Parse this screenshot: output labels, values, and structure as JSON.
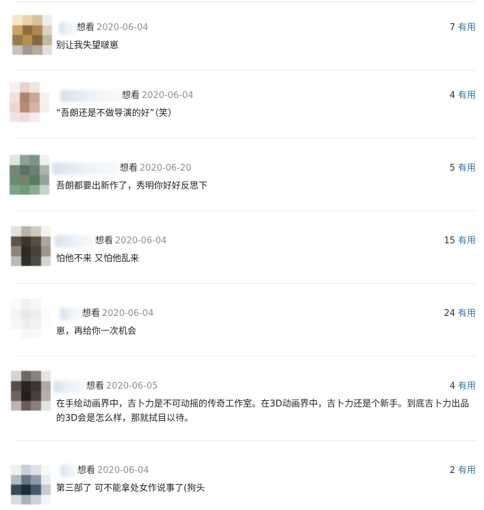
{
  "comments": [
    {
      "status": "想看",
      "date": "2020-06-04",
      "votes": "7",
      "useful": "有用",
      "content": "别让我失望啵崽"
    },
    {
      "status": "想看",
      "date": "2020-06-04",
      "votes": "4",
      "useful": "有用",
      "content": "“吾朗还是不做导演的好”（笑）"
    },
    {
      "status": "想看",
      "date": "2020-06-20",
      "votes": "5",
      "useful": "有用",
      "content": "吾朗都要出新作了，秀明你好好反思下"
    },
    {
      "status": "想看",
      "date": "2020-06-04",
      "votes": "15",
      "useful": "有用",
      "content": "怕他不来 又怕他乱来"
    },
    {
      "status": "想看",
      "date": "2020-06-04",
      "votes": "24",
      "useful": "有用",
      "content": "崽，再给你一次机会"
    },
    {
      "status": "想看",
      "date": "2020-06-05",
      "votes": "4",
      "useful": "有用",
      "content": "在手绘动画界中，吉卜力是不可动摇的传奇工作室。在3D动画界中，吉卜力还是个新手。到底吉卜力出品的3D会是怎么样，那就拭目以待。"
    },
    {
      "status": "想看",
      "date": "2020-06-04",
      "votes": "2",
      "useful": "有用",
      "content": "第三部了 可不能拿处女作说事了(狗头"
    }
  ],
  "avatar_palettes": [
    [
      "#f3e6c6",
      "#e7d3ad",
      "#d7c29b",
      "#eef0ee",
      "#c9a36a",
      "#8f6d3f",
      "#b08850",
      "#d9d2c4",
      "#9a7a4e",
      "#b8914f",
      "#826845",
      "#c5b79e",
      "#c8c4bd",
      "#9f9b93",
      "#b3ab9c",
      "#e2e0dc"
    ],
    [
      "#f6f1ef",
      "#e4d4cd",
      "#f0e4df",
      "#ffffff",
      "#ede2dc",
      "#a98570",
      "#c9a894",
      "#f8f2ef",
      "#e9d7d0",
      "#b98a78",
      "#d4b2a4",
      "#f7efec",
      "#f3e4e4",
      "#f0dede",
      "#f6eaea",
      "#ffffff"
    ],
    [
      "#dfe6e1",
      "#8fa295",
      "#7f9488",
      "#eef2ef",
      "#73887b",
      "#5f7062",
      "#6d8173",
      "#a8b7ad",
      "#6a8a72",
      "#78826a",
      "#5d7a62",
      "#93a596",
      "#7ea58a",
      "#6f9b7b",
      "#88ad92",
      "#c4d4c8"
    ],
    [
      "#e2e2df",
      "#b7b3ad",
      "#cfcbc4",
      "#f4f3f1",
      "#5d5448",
      "#3e362c",
      "#5a4d3e",
      "#aaa59d",
      "#8d8578",
      "#302a22",
      "#4a4237",
      "#9e978c",
      "#b9bbb6",
      "#2f2f2c",
      "#4a4a46",
      "#d3d3cf"
    ],
    [
      "#fbfbfb",
      "#f1f1f1",
      "#f7f7f7",
      "#ffffff",
      "#f4f2f2",
      "#ebe8e8",
      "#f0eded",
      "#fbfbfb",
      "#f7f5f5",
      "#efeded",
      "#f3f1f1",
      "#fdfdfd",
      "#ffffff",
      "#f7f7f7",
      "#fafafa",
      "#ffffff"
    ],
    [
      "#d6d3d1",
      "#6e6766",
      "#8a8280",
      "#e7e5e4",
      "#554c4c",
      "#2a2322",
      "#3e3434",
      "#b0a9a8",
      "#73625f",
      "#241f1e",
      "#4a3f3d",
      "#b5aeac",
      "#bdb4b1",
      "#6a5c58",
      "#8c7f7b",
      "#e6e2e0"
    ],
    [
      "#eef0f2",
      "#c9d1d8",
      "#dfe3e7",
      "#f8f9fa",
      "#b1bcc6",
      "#657584",
      "#8e9aa5",
      "#e9edf0",
      "#3b4955",
      "#1f2b36",
      "#49586a",
      "#c4ccd3",
      "#d5dbe0",
      "#a7b3bd",
      "#ccd4da",
      "#f3f5f6"
    ]
  ]
}
